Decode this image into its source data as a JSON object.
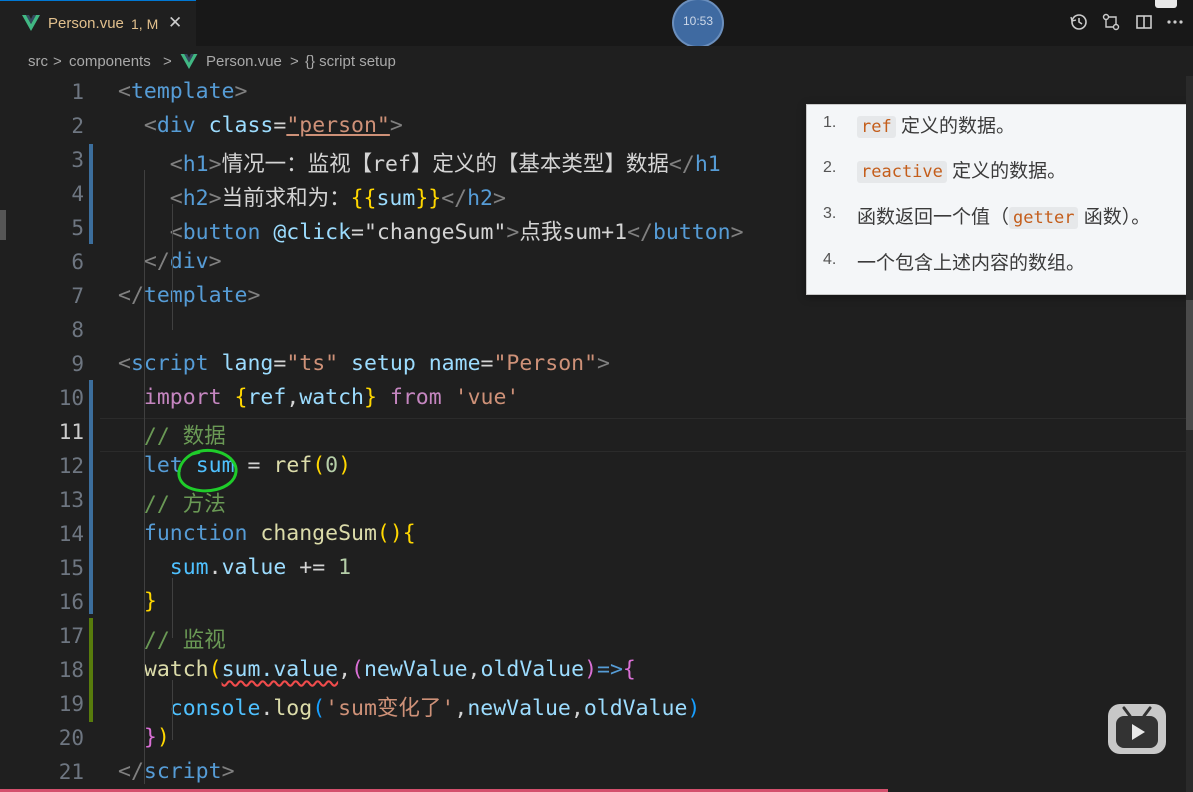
{
  "tab": {
    "name": "Person.vue",
    "status": "1, M",
    "close": "✕"
  },
  "clock": "10:53",
  "toolbar_icons": [
    "history-icon",
    "source-control-icon",
    "split-editor-icon",
    "more-icon"
  ],
  "breadcrumb": {
    "src": "src",
    "sep": ">",
    "components": "components",
    "file": "Person.vue",
    "symbol": "{} script setup"
  },
  "lines": [
    {
      "n": "1"
    },
    {
      "n": "2"
    },
    {
      "n": "3"
    },
    {
      "n": "4"
    },
    {
      "n": "5"
    },
    {
      "n": "6"
    },
    {
      "n": "7"
    },
    {
      "n": "8"
    },
    {
      "n": "9"
    },
    {
      "n": "10"
    },
    {
      "n": "11"
    },
    {
      "n": "12"
    },
    {
      "n": "13"
    },
    {
      "n": "14"
    },
    {
      "n": "15"
    },
    {
      "n": "16"
    },
    {
      "n": "17"
    },
    {
      "n": "18"
    },
    {
      "n": "19"
    },
    {
      "n": "20"
    },
    {
      "n": "21"
    }
  ],
  "code": [
    [
      [
        "<",
        "#808080"
      ],
      [
        "template",
        "#569cd6"
      ],
      [
        ">",
        "#808080"
      ]
    ],
    [
      [
        "  <",
        "#808080"
      ],
      [
        "div",
        "#569cd6"
      ],
      [
        " ",
        "#d4d4d4"
      ],
      [
        "class",
        "#9cdcfe"
      ],
      [
        "=",
        "#d4d4d4"
      ],
      [
        "\"person\"",
        "#ce9178"
      ],
      [
        ">",
        "#808080"
      ]
    ],
    [
      [
        "    <",
        "#808080"
      ],
      [
        "h1",
        "#569cd6"
      ],
      [
        ">",
        "#808080"
      ],
      [
        "情况一：监视【ref】定义的【基本类型】数据",
        "#d4d4d4"
      ],
      [
        "</",
        "#808080"
      ],
      [
        "h1",
        "#569cd6"
      ]
    ],
    [
      [
        "    <",
        "#808080"
      ],
      [
        "h2",
        "#569cd6"
      ],
      [
        ">",
        "#808080"
      ],
      [
        "当前求和为：",
        "#d4d4d4"
      ],
      [
        "{{",
        "#ffd700"
      ],
      [
        "sum",
        "#9cdcfe"
      ],
      [
        "}}",
        "#ffd700"
      ],
      [
        "</",
        "#808080"
      ],
      [
        "h2",
        "#569cd6"
      ],
      [
        ">",
        "#808080"
      ]
    ],
    [
      [
        "    <",
        "#808080"
      ],
      [
        "button",
        "#569cd6"
      ],
      [
        " ",
        "#d4d4d4"
      ],
      [
        "@click",
        "#9cdcfe"
      ],
      [
        "=",
        "#d4d4d4"
      ],
      [
        "\"changeSum\"",
        "#d4d4d4"
      ],
      [
        ">",
        "#808080"
      ],
      [
        "点我sum+1",
        "#d4d4d4"
      ],
      [
        "</",
        "#808080"
      ],
      [
        "button",
        "#569cd6"
      ],
      [
        ">",
        "#808080"
      ]
    ],
    [
      [
        "  </",
        "#808080"
      ],
      [
        "div",
        "#569cd6"
      ],
      [
        ">",
        "#808080"
      ]
    ],
    [
      [
        "</",
        "#808080"
      ],
      [
        "template",
        "#569cd6"
      ],
      [
        ">",
        "#808080"
      ]
    ],
    [],
    [
      [
        "<",
        "#808080"
      ],
      [
        "script",
        "#569cd6"
      ],
      [
        " ",
        "#d4d4d4"
      ],
      [
        "lang",
        "#9cdcfe"
      ],
      [
        "=",
        "#d4d4d4"
      ],
      [
        "\"ts\"",
        "#ce9178"
      ],
      [
        " ",
        "#d4d4d4"
      ],
      [
        "setup",
        "#9cdcfe"
      ],
      [
        " ",
        "#d4d4d4"
      ],
      [
        "name",
        "#9cdcfe"
      ],
      [
        "=",
        "#d4d4d4"
      ],
      [
        "\"Person\"",
        "#ce9178"
      ],
      [
        ">",
        "#808080"
      ]
    ],
    [
      [
        "  ",
        "#d4d4d4"
      ],
      [
        "import",
        "#c586c0"
      ],
      [
        " ",
        "#d4d4d4"
      ],
      [
        "{",
        "#ffd700"
      ],
      [
        "ref",
        "#9cdcfe"
      ],
      [
        ",",
        "#d4d4d4"
      ],
      [
        "watch",
        "#9cdcfe"
      ],
      [
        "}",
        "#ffd700"
      ],
      [
        " ",
        "#d4d4d4"
      ],
      [
        "from",
        "#c586c0"
      ],
      [
        " ",
        "#d4d4d4"
      ],
      [
        "'vue'",
        "#ce9178"
      ]
    ],
    [
      [
        "  ",
        "#d4d4d4"
      ],
      [
        "// 数据",
        "#6a9955"
      ]
    ],
    [
      [
        "  ",
        "#d4d4d4"
      ],
      [
        "let",
        "#569cd6"
      ],
      [
        " ",
        "#d4d4d4"
      ],
      [
        "sum",
        "#4fc1ff"
      ],
      [
        " = ",
        "#d4d4d4"
      ],
      [
        "ref",
        "#dcdcaa"
      ],
      [
        "(",
        "#ffd700"
      ],
      [
        "0",
        "#b5cea8"
      ],
      [
        ")",
        "#ffd700"
      ]
    ],
    [
      [
        "  ",
        "#d4d4d4"
      ],
      [
        "// 方法",
        "#6a9955"
      ]
    ],
    [
      [
        "  ",
        "#d4d4d4"
      ],
      [
        "function",
        "#569cd6"
      ],
      [
        " ",
        "#d4d4d4"
      ],
      [
        "changeSum",
        "#dcdcaa"
      ],
      [
        "(){",
        "#ffd700"
      ]
    ],
    [
      [
        "    ",
        "#d4d4d4"
      ],
      [
        "sum",
        "#4fc1ff"
      ],
      [
        ".",
        "#d4d4d4"
      ],
      [
        "value",
        "#9cdcfe"
      ],
      [
        " += ",
        "#d4d4d4"
      ],
      [
        "1",
        "#b5cea8"
      ]
    ],
    [
      [
        "  ",
        "#d4d4d4"
      ],
      [
        "}",
        "#ffd700"
      ]
    ],
    [
      [
        "  ",
        "#d4d4d4"
      ],
      [
        "// 监视",
        "#6a9955"
      ]
    ],
    [
      [
        "  ",
        "#d4d4d4"
      ],
      [
        "watch",
        "#dcdcaa"
      ],
      [
        "(",
        "#ffd700"
      ],
      [
        "sum.value",
        "#9cdcfe"
      ],
      [
        ",",
        "#d4d4d4"
      ],
      [
        "(",
        "#da70d6"
      ],
      [
        "newValue",
        "#9cdcfe"
      ],
      [
        ",",
        "#d4d4d4"
      ],
      [
        "oldValue",
        "#9cdcfe"
      ],
      [
        ")",
        "#da70d6"
      ],
      [
        "=>",
        "#569cd6"
      ],
      [
        "{",
        "#da70d6"
      ]
    ],
    [
      [
        "    ",
        "#d4d4d4"
      ],
      [
        "console",
        "#4fc1ff"
      ],
      [
        ".",
        "#d4d4d4"
      ],
      [
        "log",
        "#dcdcaa"
      ],
      [
        "(",
        "#179fff"
      ],
      [
        "'sum变化了'",
        "#ce9178"
      ],
      [
        ",",
        "#d4d4d4"
      ],
      [
        "newValue",
        "#9cdcfe"
      ],
      [
        ",",
        "#d4d4d4"
      ],
      [
        "oldValue",
        "#9cdcfe"
      ],
      [
        ")",
        "#179fff"
      ]
    ],
    [
      [
        "  ",
        "#d4d4d4"
      ],
      [
        "}",
        "#da70d6"
      ],
      [
        ")",
        "#ffd700"
      ]
    ],
    [
      [
        "</",
        "#808080"
      ],
      [
        "script",
        "#569cd6"
      ],
      [
        ">",
        "#808080"
      ]
    ]
  ],
  "hover": {
    "items": [
      {
        "num": "1.",
        "code": "ref",
        "text": "定义的数据。"
      },
      {
        "num": "2.",
        "code": "reactive",
        "text": "定义的数据。"
      },
      {
        "num": "3.",
        "pre": "函数返回一个值（",
        "code": "getter",
        "text": "函数）。"
      },
      {
        "num": "4.",
        "text": "一个包含上述内容的数组。"
      }
    ]
  },
  "colors": {
    "editor_bg": "#1f1f1f",
    "accent": "#0078d4",
    "modified": "#e2c08d",
    "vue_green": "#41b883",
    "annotation_circle": "#1fcc2a"
  }
}
